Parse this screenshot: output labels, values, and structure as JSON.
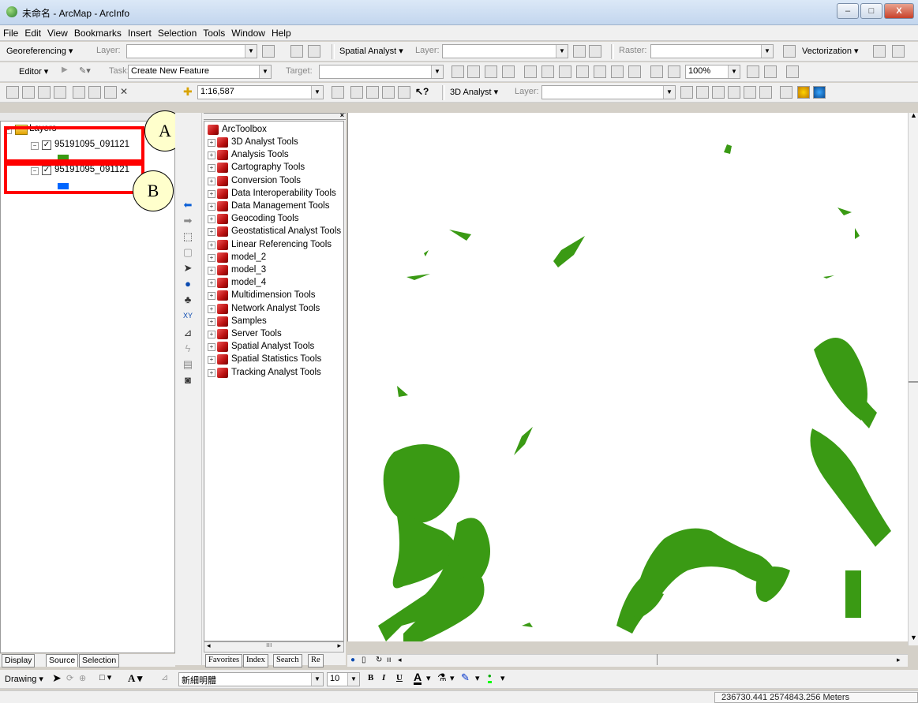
{
  "window": {
    "title": "未命名 - ArcMap - ArcInfo",
    "min_label": "–",
    "max_label": "□",
    "close_label": "X"
  },
  "menu": [
    "File",
    "Edit",
    "View",
    "Bookmarks",
    "Insert",
    "Selection",
    "Tools",
    "Window",
    "Help"
  ],
  "toolbar1": {
    "georef_label": "Georeferencing ▾",
    "layer_label": "Layer:",
    "spatial_label": "Spatial Analyst ▾",
    "layer2_label": "Layer:",
    "raster_label": "Raster:",
    "vector_label": "Vectorization ▾"
  },
  "toolbar2": {
    "editor_label": "Editor ▾",
    "task_label": "Task:",
    "task_value": "Create New Feature",
    "target_label": "Target:",
    "zoom_value": "100%"
  },
  "toolbar3": {
    "scale_value": "1:16,587",
    "analyst3d_label": "3D Analyst ▾",
    "layer_label": "Layer:"
  },
  "toc": {
    "root_label": "Layers",
    "layers": [
      {
        "name": "95191095_091121",
        "swatch": "#3a9a14"
      },
      {
        "name": "95191095_091121",
        "swatch": "#0066ff"
      }
    ],
    "tabs": [
      "Display",
      "Source",
      "Selection"
    ]
  },
  "callouts": {
    "a": "A",
    "b": "B"
  },
  "toolbox": {
    "root": "ArcToolbox",
    "items": [
      "3D Analyst Tools",
      "Analysis Tools",
      "Cartography Tools",
      "Conversion Tools",
      "Data Interoperability Tools",
      "Data Management Tools",
      "Geocoding Tools",
      "Geostatistical Analyst Tools",
      "Linear Referencing Tools",
      "model_2",
      "model_3",
      "model_4",
      "Multidimension Tools",
      "Network Analyst Tools",
      "Samples",
      "Server Tools",
      "Spatial Analyst Tools",
      "Spatial Statistics Tools",
      "Tracking Analyst Tools"
    ],
    "tabs": [
      "Favorites",
      "Index",
      "Search",
      "Re"
    ]
  },
  "drawing": {
    "drawing_label": "Drawing ▾",
    "font_value": "新細明體",
    "size_value": "10",
    "bold": "B",
    "italic": "I",
    "underline": "U"
  },
  "status": {
    "coordinates": "236730.441  2574843.256 Meters"
  },
  "colors": {
    "land": "#3a9a14",
    "annotation_red": "#ff0000",
    "callout_fill": "#ffffcc"
  }
}
